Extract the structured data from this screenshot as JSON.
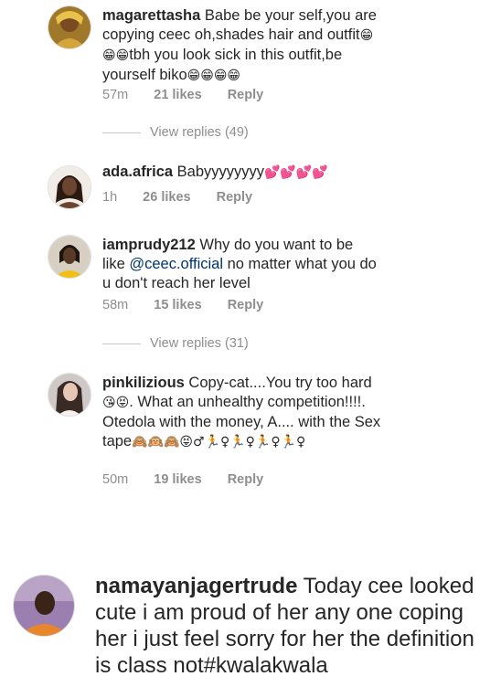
{
  "comments": [
    {
      "username": "magarettasha",
      "text_a": " Babe be your self,you are copying ceec oh,shades hair and outfit",
      "emoji_a": "😁😁😁",
      "text_b": "tbh you look sick in this outfit,be yourself biko",
      "emoji_b": "😁😁😁😁",
      "time": "57m",
      "likes": "21 likes",
      "reply": "Reply",
      "view_replies": "View replies (49)"
    },
    {
      "username": "ada.africa",
      "text_a": " Babyyyyyyyy",
      "emoji_a": "💕💕💕💕",
      "time": "1h",
      "likes": "26 likes",
      "reply": "Reply"
    },
    {
      "username": "iamprudy212",
      "text_a": " Why do you want to be like ",
      "mention": "@ceec.official",
      "text_b": "  no matter what you do u don't reach her level",
      "time": "58m",
      "likes": "15 likes",
      "reply": "Reply",
      "view_replies": "View replies (31)"
    },
    {
      "username": "pinkilizious",
      "text_a": " Copy-cat....You try too hard",
      "emoji_a": "😘😝",
      "text_b": ". What an unhealthy competition!!!!. Otedola with the money, A.... with the Sex tape",
      "emoji_b": "🙈🙉🙈😝♂🏃♀🏃♀🏃♀🏃♀",
      "time": "50m",
      "likes": "19 likes",
      "reply": "Reply"
    },
    {
      "username": "namayanjagertrude",
      "text_a": " Today cee looked cute i am proud of her any one coping her i just feel sorry for her the definition is class not#kwalakwala"
    }
  ],
  "icons": {
    "avatar1": "avatar-woman-gold",
    "avatar2": "avatar-woman-dark",
    "avatar3": "avatar-woman-yellow",
    "avatar4": "avatar-woman-light",
    "avatar5": "avatar-woman-purple"
  }
}
